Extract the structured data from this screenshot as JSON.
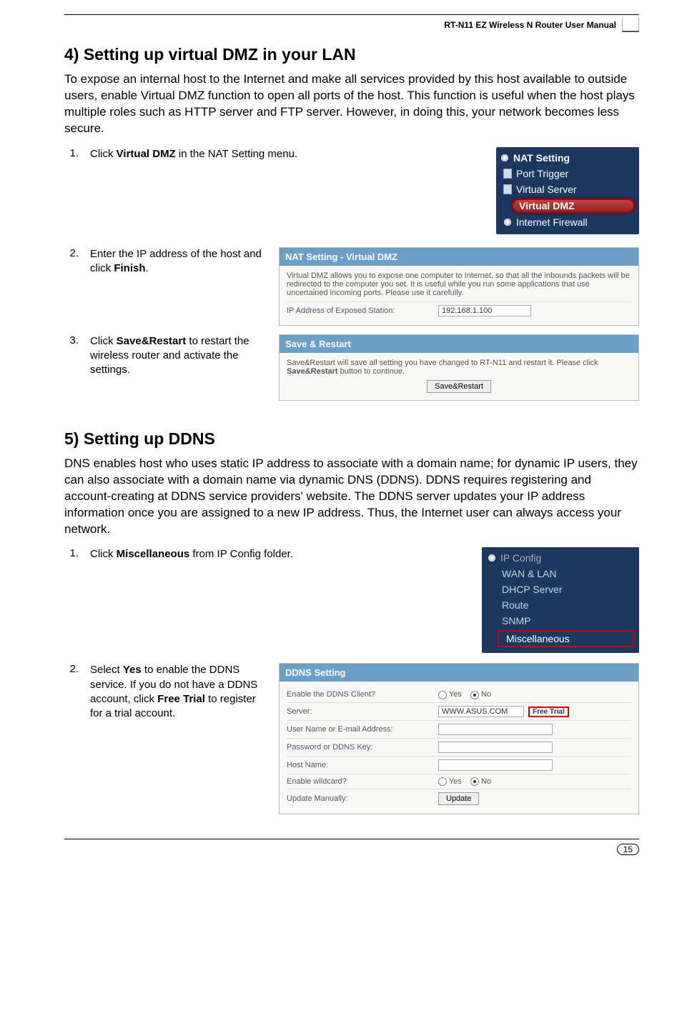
{
  "header": {
    "product_line": "RT-N11 EZ Wireless N Router User Manual"
  },
  "section4": {
    "title": "4) Setting up virtual DMZ in your LAN",
    "intro": "To expose an internal host to the Internet and make all services provided by this host available to outside users, enable Virtual DMZ function to open all ports of the host. This function is useful when the host plays multiple roles such as HTTP server and FTP server. However, in doing this, your network becomes less secure.",
    "step1": {
      "num": "1.",
      "text_pre": "Click ",
      "bold": "Virtual DMZ",
      "text_post": " in the NAT Setting menu."
    },
    "nat_menu": {
      "head": "NAT Setting",
      "items": [
        "Port Trigger",
        "Virtual Server",
        "Virtual DMZ",
        "Internet Firewall"
      ]
    },
    "step2": {
      "num": "2.",
      "text": "Enter the IP address of the host and click ",
      "bold": "Finish",
      "post": "."
    },
    "panel_dmz": {
      "title": "NAT Setting - Virtual DMZ",
      "desc": "Virtual DMZ allows you to expose one computer to Internet, so that all the inbounds packets will be redirected to the computer you set. It is useful while you run some applications that use uncertained incoming ports. Please use it carefully.",
      "label": "IP Address of Exposed Station:",
      "value": "192.168.1.100"
    },
    "step3": {
      "num": "3.",
      "text": "Click ",
      "bold": "Save&Restart",
      "post": " to restart the wireless router and activate the settings."
    },
    "panel_save": {
      "title": "Save & Restart",
      "desc_pre": "Save&Restart will save all setting you have changed to RT-N11 and restart it. Please click ",
      "desc_bold": "Save&Restart",
      "desc_post": " button to continue.",
      "button": "Save&Restart"
    }
  },
  "section5": {
    "title": "5) Setting up DDNS",
    "intro": "DNS enables host who uses static IP address to associate with a domain name; for dynamic IP users, they can also associate with a domain name via dynamic DNS (DDNS). DDNS requires registering and account-creating at DDNS service providers' website. The DDNS server updates your IP address information once you are assigned to a new IP address. Thus, the Internet user can always access your network.",
    "step1": {
      "num": "1.",
      "text": "Click ",
      "bold": "Miscellaneous",
      "post": " from IP Config folder."
    },
    "ip_menu": {
      "head": "IP Config",
      "items": [
        "WAN & LAN",
        "DHCP Server",
        "Route",
        "SNMP",
        "Miscellaneous"
      ]
    },
    "step2": {
      "num": "2.",
      "text": "Select ",
      "bold1": "Yes",
      "mid": " to enable the DDNS service. If you do not have a DDNS account, click ",
      "bold2": "Free Trial",
      "post": " to register for a trial account."
    },
    "panel_ddns": {
      "title": "DDNS Setting",
      "rows": {
        "enable_label": "Enable the DDNS Client?",
        "enable_yes": "Yes",
        "enable_no": "No",
        "server_label": "Server:",
        "server_value": "WWW.ASUS.COM",
        "free_trial": "Free Trial",
        "user_label": "User Name or E-mail Address:",
        "pass_label": "Password or DDNS Key:",
        "host_label": "Host Name:",
        "wildcard_label": "Enable wildcard?",
        "wildcard_yes": "Yes",
        "wildcard_no": "No",
        "update_label": "Update Manually:",
        "update_btn": "Update"
      }
    }
  },
  "footer": {
    "page": "15"
  }
}
